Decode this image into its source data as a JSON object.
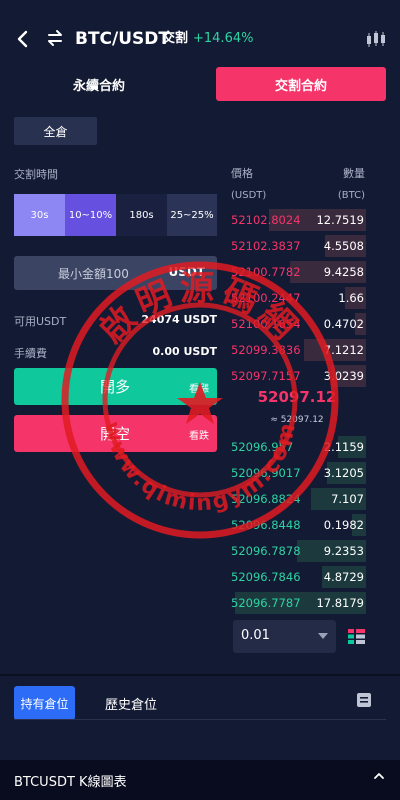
{
  "header": {
    "back_icon": "chevron-left-icon",
    "swap_icon": "swap-icon",
    "pair": "BTC/USDT",
    "type": "交割",
    "change": "+14.64%",
    "chart_icon": "candlestick-icon"
  },
  "tabs": {
    "perpetual": "永續合約",
    "option": "交割合約"
  },
  "margin_mode": "全倉",
  "form": {
    "time_label": "交割時間",
    "time_options": [
      {
        "duration": "30s",
        "ratio": ""
      },
      {
        "duration": "",
        "ratio": "10~10%"
      },
      {
        "duration": "180s",
        "ratio": ""
      },
      {
        "duration": "",
        "ratio": "25~25%"
      }
    ],
    "amount_placeholder": "最小金額100",
    "amount_unit": "USDT",
    "available_label": "可用USDT",
    "available_value": "24074 USDT",
    "fee_label": "手續費",
    "fee_value": "0.00 USDT",
    "buy_label": "開多",
    "buy_sub": "看漲",
    "sell_label": "開空",
    "sell_sub": "看跌"
  },
  "orderbook": {
    "price_header": "價格",
    "qty_header": "數量",
    "price_unit": "(USDT)",
    "qty_unit": "(BTC)",
    "asks": [
      {
        "price": "52102.8024",
        "qty": "12.7519",
        "depth": 0.7
      },
      {
        "price": "52102.3837",
        "qty": "4.5508",
        "depth": 0.3
      },
      {
        "price": "52100.7782",
        "qty": "9.4258",
        "depth": 0.55
      },
      {
        "price": "52100.2447",
        "qty": "1.66",
        "depth": 0.15
      },
      {
        "price": "52100.1654",
        "qty": "0.4702",
        "depth": 0.08
      },
      {
        "price": "52099.3836",
        "qty": "7.1212",
        "depth": 0.45
      },
      {
        "price": "52097.7157",
        "qty": "3.0239",
        "depth": 0.25
      }
    ],
    "last_price": "52097.12",
    "last_price_sub": "≈ 52097.12",
    "bids": [
      {
        "price": "52096.957",
        "qty": "2.1159",
        "depth": 0.2
      },
      {
        "price": "52096.9017",
        "qty": "3.1205",
        "depth": 0.28
      },
      {
        "price": "52096.8824",
        "qty": "7.107",
        "depth": 0.4
      },
      {
        "price": "52096.8448",
        "qty": "0.1982",
        "depth": 0.1
      },
      {
        "price": "52096.7878",
        "qty": "9.2353",
        "depth": 0.5
      },
      {
        "price": "52096.7846",
        "qty": "4.8729",
        "depth": 0.32
      },
      {
        "price": "52096.7787",
        "qty": "17.8179",
        "depth": 0.95
      }
    ],
    "precision": "0.01"
  },
  "positions": {
    "holding_tab": "持有倉位",
    "history_tab": "歷史倉位"
  },
  "bottom": {
    "symbol": "BTCUSDT",
    "chart_label": "K線圖表"
  },
  "stamp": {
    "top_text": "啟明源碼網",
    "bottom_text": "www.qimingym.com"
  },
  "colors": {
    "accent_pink": "#f5356a",
    "accent_green": "#0fc99c",
    "background": "#131a33"
  }
}
